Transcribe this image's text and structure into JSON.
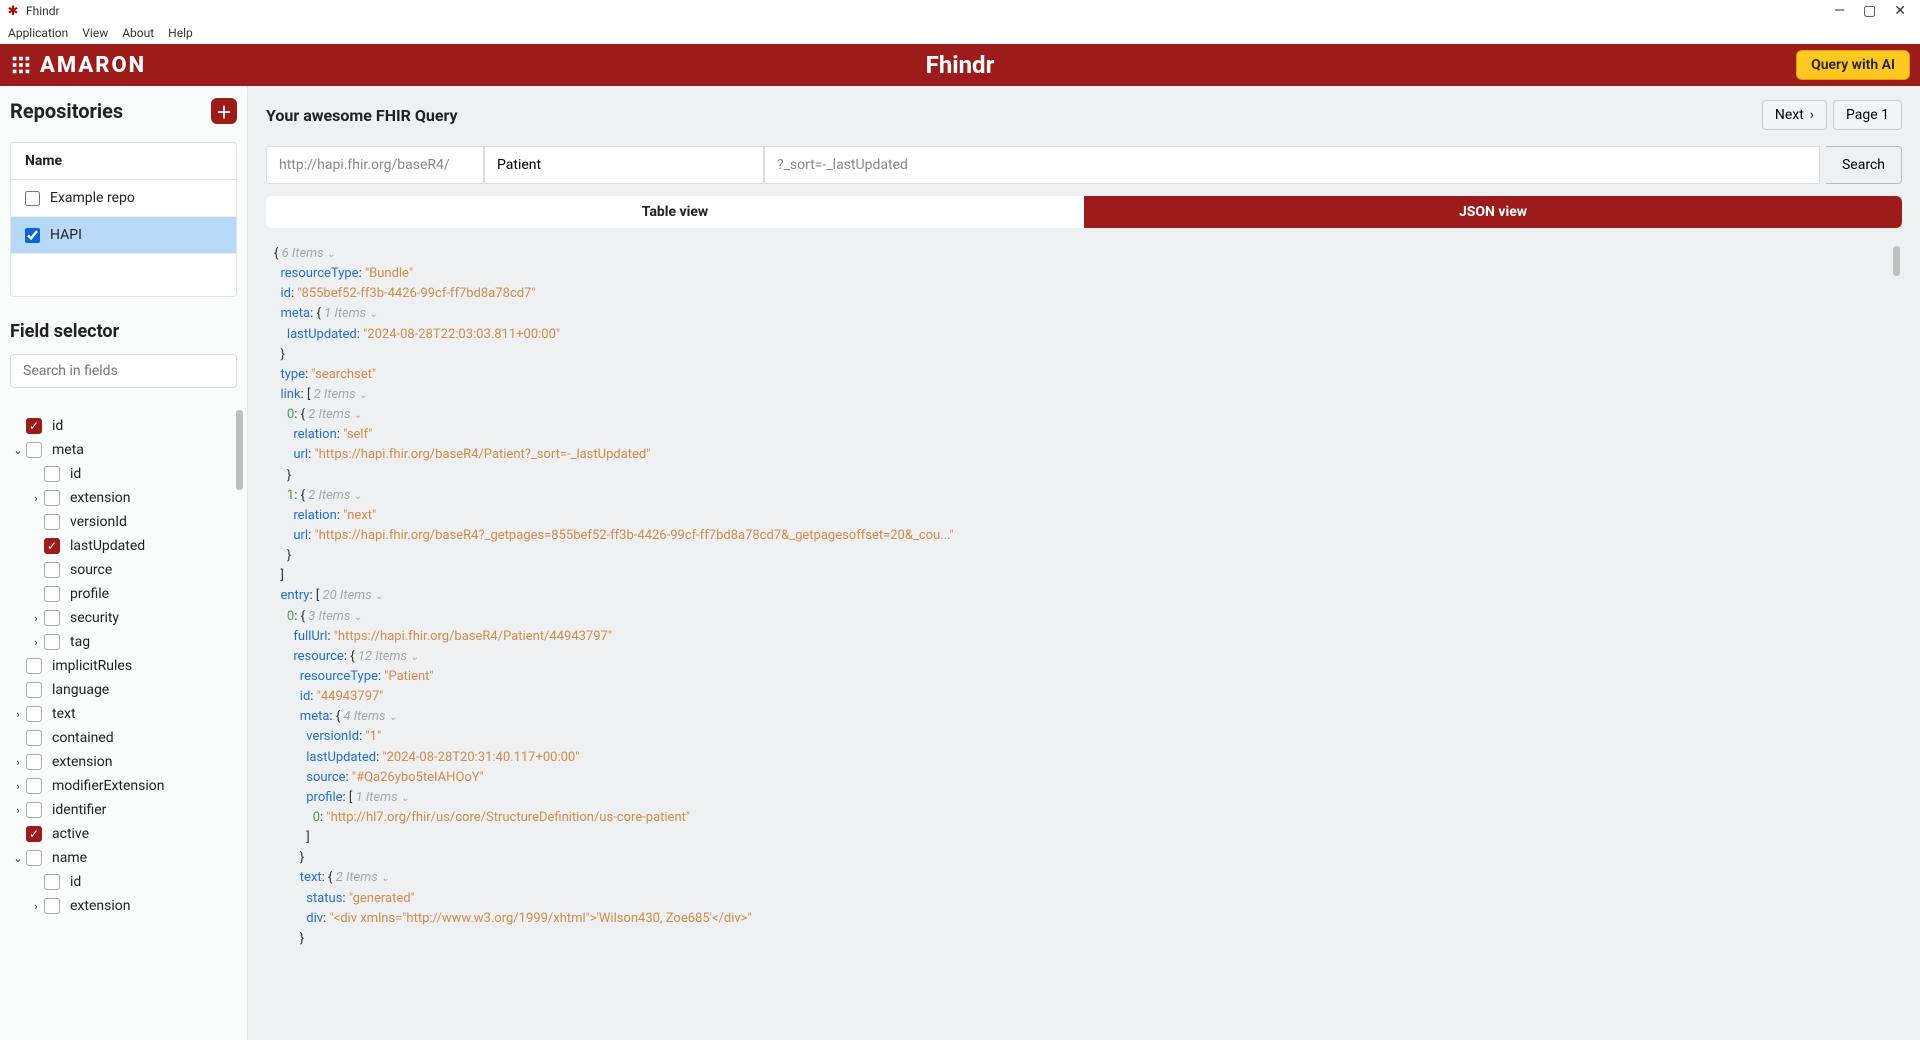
{
  "window": {
    "title": "Fhindr"
  },
  "menubar": [
    "Application",
    "View",
    "About",
    "Help"
  ],
  "header": {
    "brand": "AMARON",
    "title": "Fhindr",
    "ai_button": "Query with AI"
  },
  "sidebar": {
    "repos_title": "Repositories",
    "repo_col": "Name",
    "repos": [
      {
        "label": "Example repo",
        "checked": false,
        "selected": false
      },
      {
        "label": "HAPI",
        "checked": true,
        "selected": true
      }
    ],
    "field_sel_title": "Field selector",
    "search_placeholder": "Search in fields",
    "tree": [
      {
        "level": 1,
        "twisty": "",
        "checked": true,
        "label": "id"
      },
      {
        "level": 1,
        "twisty": "v",
        "checked": false,
        "label": "meta"
      },
      {
        "level": 2,
        "twisty": "",
        "checked": false,
        "label": "id"
      },
      {
        "level": 2,
        "twisty": ">",
        "checked": false,
        "label": "extension"
      },
      {
        "level": 2,
        "twisty": "",
        "checked": false,
        "label": "versionId"
      },
      {
        "level": 2,
        "twisty": "",
        "checked": true,
        "label": "lastUpdated"
      },
      {
        "level": 2,
        "twisty": "",
        "checked": false,
        "label": "source"
      },
      {
        "level": 2,
        "twisty": "",
        "checked": false,
        "label": "profile"
      },
      {
        "level": 2,
        "twisty": ">",
        "checked": false,
        "label": "security"
      },
      {
        "level": 2,
        "twisty": ">",
        "checked": false,
        "label": "tag"
      },
      {
        "level": 1,
        "twisty": "",
        "checked": false,
        "label": "implicitRules"
      },
      {
        "level": 1,
        "twisty": "",
        "checked": false,
        "label": "language"
      },
      {
        "level": 1,
        "twisty": ">",
        "checked": false,
        "label": "text"
      },
      {
        "level": 1,
        "twisty": "",
        "checked": false,
        "label": "contained"
      },
      {
        "level": 1,
        "twisty": ">",
        "checked": false,
        "label": "extension"
      },
      {
        "level": 1,
        "twisty": ">",
        "checked": false,
        "label": "modifierExtension"
      },
      {
        "level": 1,
        "twisty": ">",
        "checked": false,
        "label": "identifier"
      },
      {
        "level": 1,
        "twisty": "",
        "checked": true,
        "label": "active"
      },
      {
        "level": 1,
        "twisty": "v",
        "checked": false,
        "label": "name"
      },
      {
        "level": 2,
        "twisty": "",
        "checked": false,
        "label": "id"
      },
      {
        "level": 2,
        "twisty": ">",
        "checked": false,
        "label": "extension"
      }
    ]
  },
  "content": {
    "title": "Your awesome FHIR Query",
    "pager": {
      "next": "Next",
      "page": "Page 1"
    },
    "query": {
      "base": "http://hapi.fhir.org/baseR4/",
      "resource": "Patient",
      "params": "?_sort=-_lastUpdated",
      "search": "Search"
    },
    "tabs": {
      "table": "Table view",
      "json": "JSON view"
    },
    "json": {
      "rootCount": "6 Items",
      "resourceType": "Bundle",
      "id": "855bef52-ff3b-4426-99cf-ff7bd8a78cd7",
      "metaCount": "1 Items",
      "meta_lastUpdated": "2024-08-28T22:03:03.811+00:00",
      "type": "searchset",
      "linkCount": "2 Items",
      "link0Count": "2 Items",
      "link0_relation": "self",
      "link0_url": "https://hapi.fhir.org/baseR4/Patient?_sort=-_lastUpdated",
      "link1Count": "2 Items",
      "link1_relation": "next",
      "link1_url": "https://hapi.fhir.org/baseR4?_getpages=855bef52-ff3b-4426-99cf-ff7bd8a78cd7&_getpagesoffset=20&_cou...",
      "entryCount": "20 Items",
      "entry0Count": "3 Items",
      "entry0_fullUrl": "https://hapi.fhir.org/baseR4/Patient/44943797",
      "resCount": "12 Items",
      "res_resourceType": "Patient",
      "res_id": "44943797",
      "res_metaCount": "4 Items",
      "res_versionId": "1",
      "res_lastUpdated": "2024-08-28T20:31:40.117+00:00",
      "res_source": "#Qa26ybo5teIAHOoY",
      "res_profileCount": "1 Items",
      "res_profile0": "http://hl7.org/fhir/us/core/StructureDefinition/us-core-patient",
      "textCount": "2 Items",
      "text_status": "generated",
      "text_div": "<div xmlns=\"http://www.w3.org/1999/xhtml\">'Wilson430, Zoe685'</div>"
    }
  }
}
